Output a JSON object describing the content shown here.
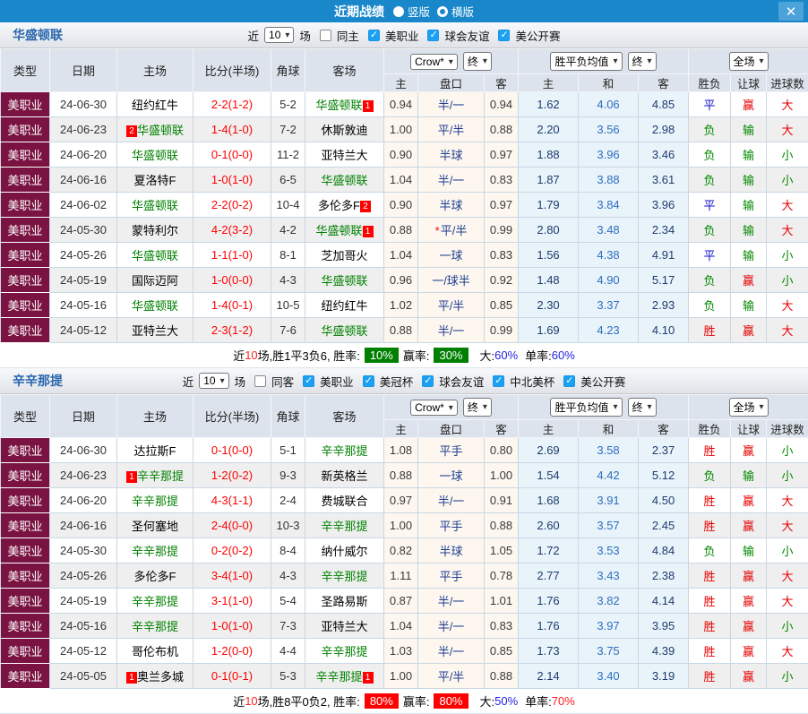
{
  "titlebar": {
    "title": "近期战绩",
    "vertical_label": "竖版",
    "horizontal_label": "横版",
    "close_glyph": "✕",
    "bar_color": "#1987c9"
  },
  "table_header": {
    "static_cols": [
      "类型",
      "日期",
      "主场",
      "比分(半场)",
      "角球",
      "客场"
    ],
    "odds_source_select": "Crow*",
    "odds_final_select": "终",
    "avg_select": "胜平负均值",
    "avg_final_select": "终",
    "scope_select": "全场",
    "sub_cols": [
      "主",
      "盘口",
      "客",
      "主",
      "和",
      "客",
      "胜负",
      "让球",
      "进球数"
    ]
  },
  "colors": {
    "type_cell": "#7a1341",
    "focus_team": "#008000",
    "score": "#ff0000",
    "win": "#e60000",
    "lose": "#008800",
    "draw": "#1111cc"
  },
  "sections": [
    {
      "team": "华盛顿联",
      "filters": {
        "near": "近",
        "count": "10",
        "games": "场",
        "same_label": "同主",
        "same_checked": false,
        "leagues": [
          {
            "label": "美职业",
            "checked": true
          },
          {
            "label": "球会友谊",
            "checked": true
          },
          {
            "label": "美公开赛",
            "checked": true
          }
        ]
      },
      "rows": [
        {
          "type": "美职业",
          "date": "24-06-30",
          "home": {
            "name": "纽约红牛"
          },
          "score": "2-2(1-2)",
          "corner": "5-2",
          "away": {
            "name": "华盛顿联",
            "focus": true,
            "badge_after": "1"
          },
          "odds": [
            "0.94",
            "半/一",
            "0.94"
          ],
          "avg": [
            "1.62",
            "4.06",
            "4.85"
          ],
          "results": [
            "平",
            "赢",
            "大"
          ]
        },
        {
          "type": "美职业",
          "date": "24-06-23",
          "home": {
            "name": "华盛顿联",
            "focus": true,
            "badge_before": "2"
          },
          "score": "1-4(1-0)",
          "corner": "7-2",
          "away": {
            "name": "休斯敦迪"
          },
          "odds": [
            "1.00",
            "平/半",
            "0.88"
          ],
          "avg": [
            "2.20",
            "3.56",
            "2.98"
          ],
          "results": [
            "负",
            "输",
            "大"
          ]
        },
        {
          "type": "美职业",
          "date": "24-06-20",
          "home": {
            "name": "华盛顿联",
            "focus": true
          },
          "score": "0-1(0-0)",
          "corner": "11-2",
          "away": {
            "name": "亚特兰大"
          },
          "odds": [
            "0.90",
            "半球",
            "0.97"
          ],
          "avg": [
            "1.88",
            "3.96",
            "3.46"
          ],
          "results": [
            "负",
            "输",
            "小"
          ]
        },
        {
          "type": "美职业",
          "date": "24-06-16",
          "home": {
            "name": "夏洛特F"
          },
          "score": "1-0(1-0)",
          "corner": "6-5",
          "away": {
            "name": "华盛顿联",
            "focus": true
          },
          "odds": [
            "1.04",
            "半/一",
            "0.83"
          ],
          "avg": [
            "1.87",
            "3.88",
            "3.61"
          ],
          "results": [
            "负",
            "输",
            "小"
          ]
        },
        {
          "type": "美职业",
          "date": "24-06-02",
          "home": {
            "name": "华盛顿联",
            "focus": true
          },
          "score": "2-2(0-2)",
          "corner": "10-4",
          "away": {
            "name": "多伦多F",
            "badge_after": "2"
          },
          "odds": [
            "0.90",
            "半球",
            "0.97"
          ],
          "avg": [
            "1.79",
            "3.84",
            "3.96"
          ],
          "results": [
            "平",
            "输",
            "大"
          ]
        },
        {
          "type": "美职业",
          "date": "24-05-30",
          "home": {
            "name": "蒙特利尔"
          },
          "score": "4-2(3-2)",
          "corner": "4-2",
          "away": {
            "name": "华盛顿联",
            "focus": true,
            "badge_after": "1"
          },
          "odds": [
            "0.88",
            "平/半",
            "0.99"
          ],
          "odds_star": true,
          "avg": [
            "2.80",
            "3.48",
            "2.34"
          ],
          "results": [
            "负",
            "输",
            "大"
          ]
        },
        {
          "type": "美职业",
          "date": "24-05-26",
          "home": {
            "name": "华盛顿联",
            "focus": true
          },
          "score": "1-1(1-0)",
          "corner": "8-1",
          "away": {
            "name": "芝加哥火"
          },
          "odds": [
            "1.04",
            "一球",
            "0.83"
          ],
          "avg": [
            "1.56",
            "4.38",
            "4.91"
          ],
          "results": [
            "平",
            "输",
            "小"
          ]
        },
        {
          "type": "美职业",
          "date": "24-05-19",
          "home": {
            "name": "国际迈阿"
          },
          "score": "1-0(0-0)",
          "corner": "4-3",
          "away": {
            "name": "华盛顿联",
            "focus": true
          },
          "odds": [
            "0.96",
            "一/球半",
            "0.92"
          ],
          "avg": [
            "1.48",
            "4.90",
            "5.17"
          ],
          "results": [
            "负",
            "赢",
            "小"
          ]
        },
        {
          "type": "美职业",
          "date": "24-05-16",
          "home": {
            "name": "华盛顿联",
            "focus": true
          },
          "score": "1-4(0-1)",
          "corner": "10-5",
          "away": {
            "name": "纽约红牛"
          },
          "odds": [
            "1.02",
            "平/半",
            "0.85"
          ],
          "avg": [
            "2.30",
            "3.37",
            "2.93"
          ],
          "results": [
            "负",
            "输",
            "大"
          ]
        },
        {
          "type": "美职业",
          "date": "24-05-12",
          "home": {
            "name": "亚特兰大"
          },
          "score": "2-3(1-2)",
          "corner": "7-6",
          "away": {
            "name": "华盛顿联",
            "focus": true
          },
          "odds": [
            "0.88",
            "半/一",
            "0.99"
          ],
          "avg": [
            "1.69",
            "4.23",
            "4.10"
          ],
          "results": [
            "胜",
            "赢",
            "大"
          ]
        }
      ],
      "summary": {
        "near": "近",
        "count": "10",
        "rest": "场,胜1平3负6, 胜率:",
        "win_rate": "10%",
        "win_rate_style": "green",
        "profit_label": "赢率:",
        "profit_rate": "30%",
        "profit_rate_style": "green",
        "big_label": "大:",
        "big_value": "60%",
        "big_style": "blue",
        "single_label": "单率:",
        "single_value": "60%",
        "single_style": "blue"
      }
    },
    {
      "team": "辛辛那提",
      "filters": {
        "near": "近",
        "count": "10",
        "games": "场",
        "same_label": "同客",
        "same_checked": false,
        "leagues": [
          {
            "label": "美职业",
            "checked": true
          },
          {
            "label": "美冠杯",
            "checked": true
          },
          {
            "label": "球会友谊",
            "checked": true
          },
          {
            "label": "中北美杯",
            "checked": true
          },
          {
            "label": "美公开赛",
            "checked": true
          }
        ]
      },
      "rows": [
        {
          "type": "美职业",
          "date": "24-06-30",
          "home": {
            "name": "达拉斯F"
          },
          "score": "0-1(0-0)",
          "corner": "5-1",
          "away": {
            "name": "辛辛那提",
            "focus": true
          },
          "odds": [
            "1.08",
            "平手",
            "0.80"
          ],
          "avg": [
            "2.69",
            "3.58",
            "2.37"
          ],
          "results": [
            "胜",
            "赢",
            "小"
          ]
        },
        {
          "type": "美职业",
          "date": "24-06-23",
          "home": {
            "name": "辛辛那提",
            "focus": true,
            "badge_before": "1"
          },
          "score": "1-2(0-2)",
          "corner": "9-3",
          "away": {
            "name": "新英格兰"
          },
          "odds": [
            "0.88",
            "一球",
            "1.00"
          ],
          "avg": [
            "1.54",
            "4.42",
            "5.12"
          ],
          "results": [
            "负",
            "输",
            "小"
          ]
        },
        {
          "type": "美职业",
          "date": "24-06-20",
          "home": {
            "name": "辛辛那提",
            "focus": true
          },
          "score": "4-3(1-1)",
          "corner": "2-4",
          "away": {
            "name": "费城联合"
          },
          "odds": [
            "0.97",
            "半/一",
            "0.91"
          ],
          "avg": [
            "1.68",
            "3.91",
            "4.50"
          ],
          "results": [
            "胜",
            "赢",
            "大"
          ]
        },
        {
          "type": "美职业",
          "date": "24-06-16",
          "home": {
            "name": "圣何塞地"
          },
          "score": "2-4(0-0)",
          "corner": "10-3",
          "away": {
            "name": "辛辛那提",
            "focus": true
          },
          "odds": [
            "1.00",
            "平手",
            "0.88"
          ],
          "avg": [
            "2.60",
            "3.57",
            "2.45"
          ],
          "results": [
            "胜",
            "赢",
            "大"
          ]
        },
        {
          "type": "美职业",
          "date": "24-05-30",
          "home": {
            "name": "辛辛那提",
            "focus": true
          },
          "score": "0-2(0-2)",
          "corner": "8-4",
          "away": {
            "name": "纳什威尔"
          },
          "odds": [
            "0.82",
            "半球",
            "1.05"
          ],
          "avg": [
            "1.72",
            "3.53",
            "4.84"
          ],
          "results": [
            "负",
            "输",
            "小"
          ]
        },
        {
          "type": "美职业",
          "date": "24-05-26",
          "home": {
            "name": "多伦多F"
          },
          "score": "3-4(1-0)",
          "corner": "4-3",
          "away": {
            "name": "辛辛那提",
            "focus": true
          },
          "odds": [
            "1.11",
            "平手",
            "0.78"
          ],
          "avg": [
            "2.77",
            "3.43",
            "2.38"
          ],
          "results": [
            "胜",
            "赢",
            "大"
          ]
        },
        {
          "type": "美职业",
          "date": "24-05-19",
          "home": {
            "name": "辛辛那提",
            "focus": true
          },
          "score": "3-1(1-0)",
          "corner": "5-4",
          "away": {
            "name": "圣路易斯"
          },
          "odds": [
            "0.87",
            "半/一",
            "1.01"
          ],
          "avg": [
            "1.76",
            "3.82",
            "4.14"
          ],
          "results": [
            "胜",
            "赢",
            "大"
          ]
        },
        {
          "type": "美职业",
          "date": "24-05-16",
          "home": {
            "name": "辛辛那提",
            "focus": true
          },
          "score": "1-0(1-0)",
          "corner": "7-3",
          "away": {
            "name": "亚特兰大"
          },
          "odds": [
            "1.04",
            "半/一",
            "0.83"
          ],
          "avg": [
            "1.76",
            "3.97",
            "3.95"
          ],
          "results": [
            "胜",
            "赢",
            "小"
          ]
        },
        {
          "type": "美职业",
          "date": "24-05-12",
          "home": {
            "name": "哥伦布机"
          },
          "score": "1-2(0-0)",
          "corner": "4-4",
          "away": {
            "name": "辛辛那提",
            "focus": true
          },
          "odds": [
            "1.03",
            "半/一",
            "0.85"
          ],
          "avg": [
            "1.73",
            "3.75",
            "4.39"
          ],
          "results": [
            "胜",
            "赢",
            "大"
          ]
        },
        {
          "type": "美职业",
          "date": "24-05-05",
          "home": {
            "name": "奥兰多城",
            "badge_before": "1"
          },
          "score": "0-1(0-1)",
          "corner": "5-3",
          "away": {
            "name": "辛辛那提",
            "focus": true,
            "badge_after": "1"
          },
          "odds": [
            "1.00",
            "平/半",
            "0.88"
          ],
          "avg": [
            "2.14",
            "3.40",
            "3.19"
          ],
          "results": [
            "胜",
            "赢",
            "小"
          ]
        }
      ],
      "summary": {
        "near": "近",
        "count": "10",
        "rest": "场,胜8平0负2, 胜率:",
        "win_rate": "80%",
        "win_rate_style": "red",
        "profit_label": "赢率:",
        "profit_rate": "80%",
        "profit_rate_style": "red",
        "big_label": "大:",
        "big_value": "50%",
        "big_style": "blue",
        "single_label": "单率:",
        "single_value": "70%",
        "single_style": "red"
      }
    }
  ]
}
